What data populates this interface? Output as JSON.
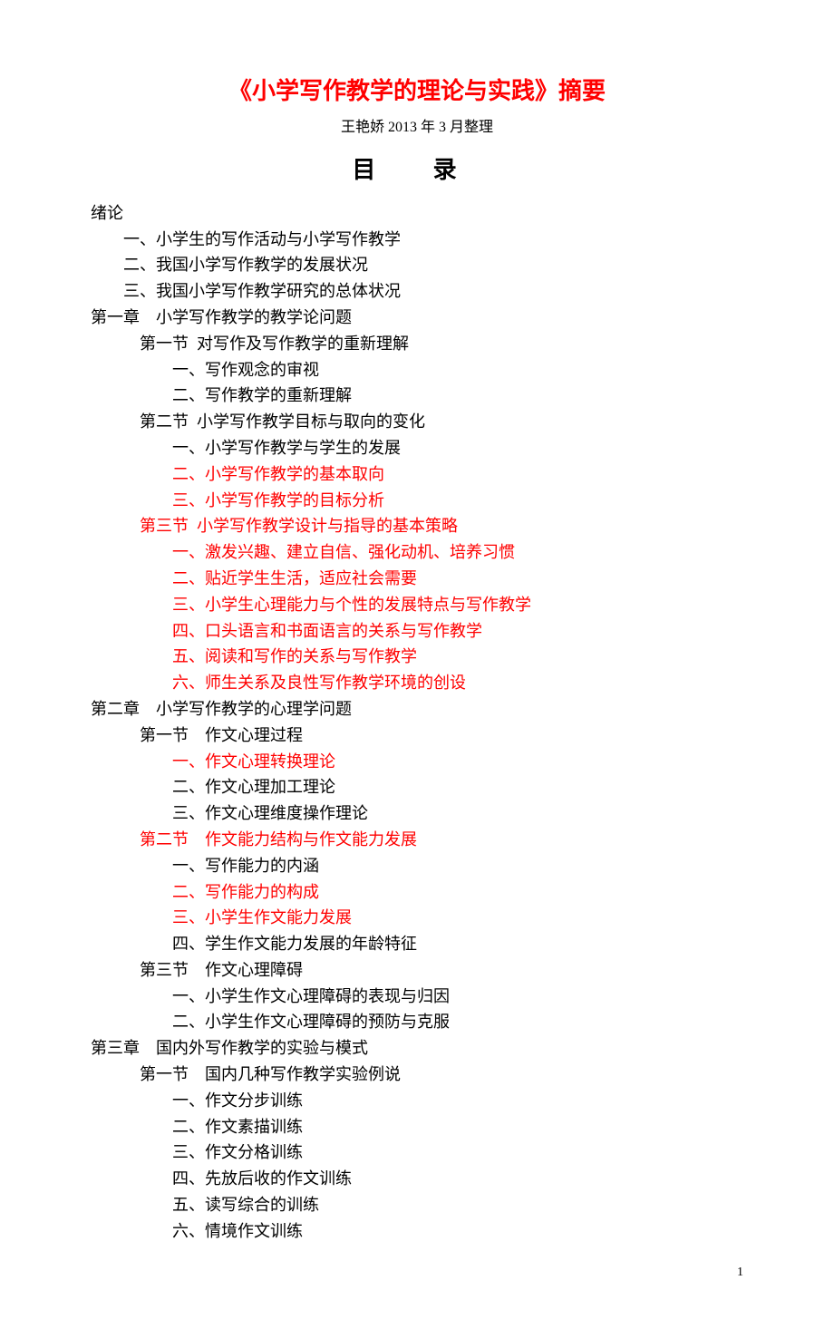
{
  "title": "《小学写作教学的理论与实践》摘要",
  "subtitle": "王艳娇 2013 年 3 月整理",
  "toc_heading": "目 录",
  "page_number": "1",
  "toc": [
    {
      "text": "绪论",
      "level": 0,
      "red": false
    },
    {
      "text": "一、小学生的写作活动与小学写作教学",
      "level": 1,
      "red": false
    },
    {
      "text": "二、我国小学写作教学的发展状况",
      "level": 1,
      "red": false
    },
    {
      "text": "三、我国小学写作教学研究的总体状况",
      "level": 1,
      "red": false
    },
    {
      "text": "第一章　小学写作教学的教学论问题",
      "level": 0,
      "red": false
    },
    {
      "text": "第一节  对写作及写作教学的重新理解",
      "level": 2,
      "red": false
    },
    {
      "text": "一、写作观念的审视",
      "level": 3,
      "red": false
    },
    {
      "text": "二、写作教学的重新理解",
      "level": 3,
      "red": false
    },
    {
      "text": "第二节  小学写作教学目标与取向的变化",
      "level": 2,
      "red": false
    },
    {
      "text": "一、小学写作教学与学生的发展",
      "level": 3,
      "red": false
    },
    {
      "text": "二、小学写作教学的基本取向",
      "level": 3,
      "red": true
    },
    {
      "text": "三、小学写作教学的目标分析",
      "level": 3,
      "red": true
    },
    {
      "text": "第三节  小学写作教学设计与指导的基本策略",
      "level": 2,
      "red": true
    },
    {
      "text": "一、激发兴趣、建立自信、强化动机、培养习惯",
      "level": 3,
      "red": true
    },
    {
      "text": "二、贴近学生生活，适应社会需要",
      "level": 3,
      "red": true
    },
    {
      "text": "三、小学生心理能力与个性的发展特点与写作教学",
      "level": 3,
      "red": true
    },
    {
      "text": "四、口头语言和书面语言的关系与写作教学",
      "level": 3,
      "red": true
    },
    {
      "text": "五、阅读和写作的关系与写作教学",
      "level": 3,
      "red": true
    },
    {
      "text": "六、师生关系及良性写作教学环境的创设",
      "level": 3,
      "red": true
    },
    {
      "text": "第二章　小学写作教学的心理学问题",
      "level": 0,
      "red": false
    },
    {
      "text": "第一节　作文心理过程",
      "level": 2,
      "red": false
    },
    {
      "text": "一、作文心理转换理论",
      "level": 3,
      "red": true
    },
    {
      "text": "二、作文心理加工理论",
      "level": 3,
      "red": false
    },
    {
      "text": "三、作文心理维度操作理论",
      "level": 3,
      "red": false
    },
    {
      "text": "第二节　作文能力结构与作文能力发展",
      "level": 2,
      "red": true
    },
    {
      "text": "一、写作能力的内涵",
      "level": 3,
      "red": false
    },
    {
      "text": "二、写作能力的构成",
      "level": 3,
      "red": true
    },
    {
      "text": "三、小学生作文能力发展",
      "level": 3,
      "red": true
    },
    {
      "text": "四、学生作文能力发展的年龄特征",
      "level": 3,
      "red": false
    },
    {
      "text": "第三节　作文心理障碍",
      "level": 2,
      "red": false
    },
    {
      "text": "一、小学生作文心理障碍的表现与归因",
      "level": 3,
      "red": false
    },
    {
      "text": "二、小学生作文心理障碍的预防与克服",
      "level": 3,
      "red": false
    },
    {
      "text": "第三章　国内外写作教学的实验与模式",
      "level": 0,
      "red": false
    },
    {
      "text": "第一节　国内几种写作教学实验例说",
      "level": 2,
      "red": false
    },
    {
      "text": "一、作文分步训练",
      "level": 3,
      "red": false
    },
    {
      "text": "二、作文素描训练",
      "level": 3,
      "red": false
    },
    {
      "text": "三、作文分格训练",
      "level": 3,
      "red": false
    },
    {
      "text": "四、先放后收的作文训练",
      "level": 3,
      "red": false
    },
    {
      "text": "五、读写综合的训练",
      "level": 3,
      "red": false
    },
    {
      "text": "六、情境作文训练",
      "level": 3,
      "red": false
    }
  ]
}
